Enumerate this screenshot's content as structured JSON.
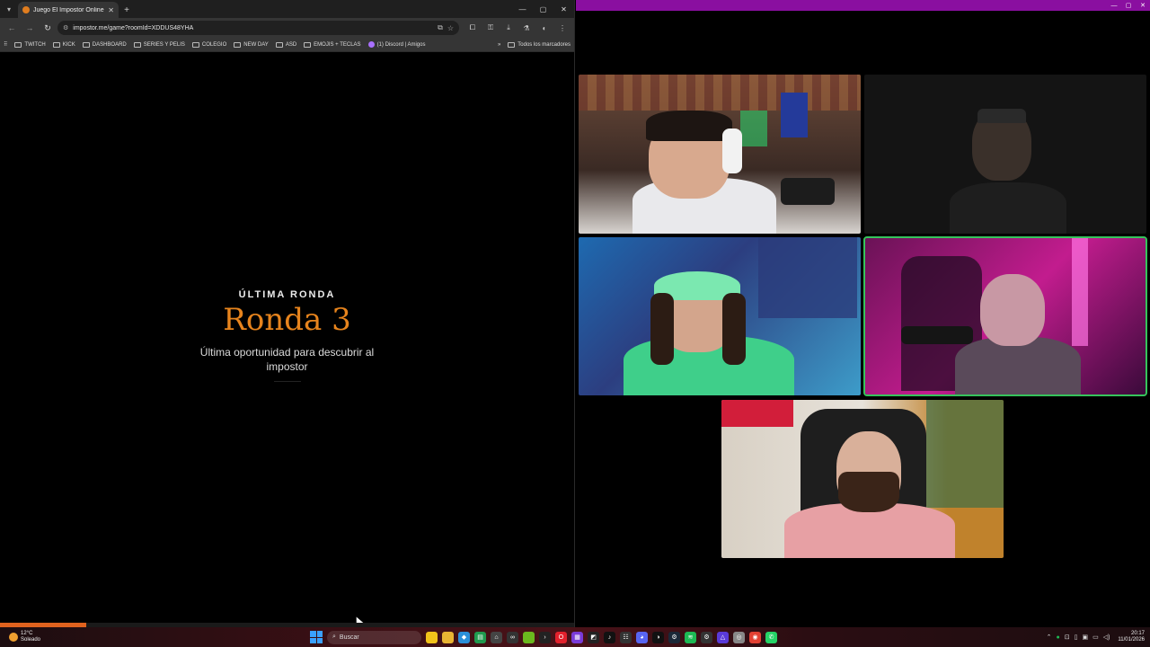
{
  "browser": {
    "tab_title": "Juego El Impostor Online - Jug",
    "url": "impostor.me/game?roomId=XDDUS48YHA",
    "bookmarks": [
      "TWITCH",
      "KICK",
      "DASHBOARD",
      "SERIES Y PELIS",
      "COLEGIO",
      "NEW DAY",
      "ASD",
      "EMOJIS + TECLAS"
    ],
    "discord_bookmark": "(1) Discord | Amigos",
    "all_bookmarks": "Todos los marcadores"
  },
  "game": {
    "eyebrow": "ÚLTIMA RONDA",
    "title": "Ronda 3",
    "subtitle": "Última oportunidad para descubrir al impostor",
    "progress_fraction": 0.15,
    "accent_color": "#e7841d"
  },
  "call": {
    "active_border_color": "#36c45c",
    "tiles": [
      "participant-1",
      "participant-2",
      "participant-3",
      "participant-4",
      "participant-5"
    ]
  },
  "taskbar": {
    "temperature": "12°C",
    "weather": "Soleado",
    "search_placeholder": "Buscar",
    "time": "20:17",
    "date": "11/01/2026"
  }
}
